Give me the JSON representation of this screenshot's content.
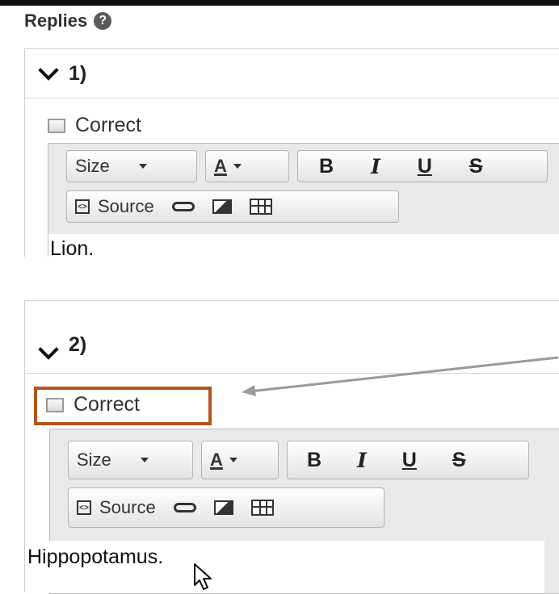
{
  "replies": {
    "title": "Replies",
    "help_icon": "question-circle-icon"
  },
  "reply1": {
    "number": "1)",
    "correct_label": "Correct",
    "toolbar": {
      "size_label": "Size",
      "font_color_label": "A",
      "bold": "B",
      "italic": "I",
      "underline": "U",
      "strike": "S",
      "source_label": "Source"
    },
    "content": "Lion."
  },
  "reply2": {
    "number": "2)",
    "correct_label": "Correct",
    "toolbar": {
      "size_label": "Size",
      "font_color_label": "A",
      "bold": "B",
      "italic": "I",
      "underline": "U",
      "strike": "S",
      "source_label": "Source"
    },
    "content": "Hippopotamus."
  },
  "colors": {
    "highlight": "#b4541c",
    "arrow": "#9a9a9a"
  }
}
